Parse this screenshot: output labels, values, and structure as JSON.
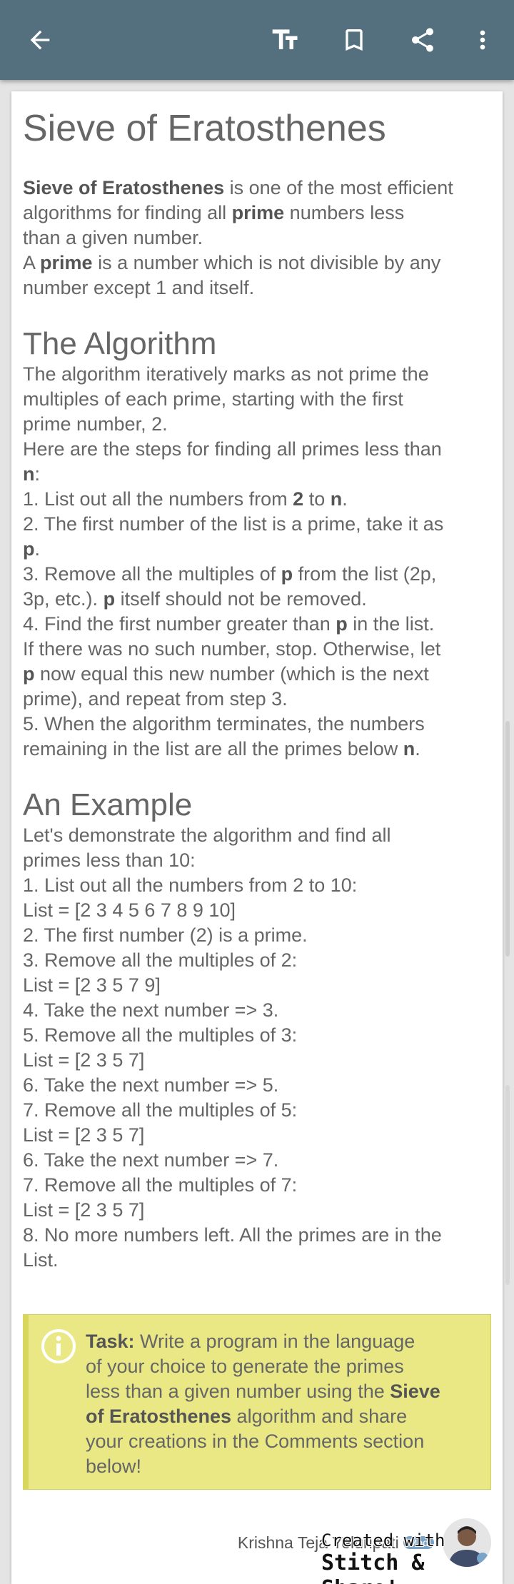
{
  "toolbar": {
    "back_icon": "arrow-left-icon",
    "text_size_icon": "text-size-icon",
    "bookmark_icon": "bookmark-icon",
    "share_icon": "share-icon",
    "more_icon": "more-vert-icon",
    "bar_color": "#54707f"
  },
  "article": {
    "title": "Sieve of Eratosthenes",
    "intro": {
      "p1_bold": "Sieve of Eratosthenes",
      "p1_a": " is one of the most efficient",
      "p1_b": "algorithms for finding all ",
      "p1_prime": "prime",
      "p1_c": " numbers less",
      "p1_d": "than a given number.",
      "p2_a": "A ",
      "p2_prime": "prime",
      "p2_b": " is a number which is not divisible by any",
      "p2_c": "number except 1 and itself."
    },
    "algorithm": {
      "heading": "The Algorithm",
      "l1": "The algorithm iteratively marks as not prime the",
      "l2": "multiples of each prime, starting with the first",
      "l3": "prime number, 2.",
      "l4": "Here are the steps for finding all primes less than",
      "l5_n": "n",
      "l5_colon": ":",
      "s1_a": "1. List out all the numbers from ",
      "s1_2": "2",
      "s1_b": " to ",
      "s1_n": "n",
      "s1_c": ".",
      "s2_a": "2. The first number of the list is a prime, take it as",
      "s2_p": "p",
      "s2_b": ".",
      "s3_a": "3. Remove all the multiples of ",
      "s3_p": "p",
      "s3_b": " from the list (2p,",
      "s3_c": "3p, etc.). ",
      "s3_p2": "p",
      "s3_d": " itself should not be removed.",
      "s4_a": "4. Find the first number greater than ",
      "s4_p": "p",
      "s4_b": " in the list.",
      "s4_c": "If there was no such number, stop. Otherwise, let",
      "s4_p2": "p",
      "s4_d": " now equal this new number (which is the next",
      "s4_e": "prime), and repeat from step 3.",
      "s5_a": "5. When the algorithm terminates, the numbers",
      "s5_b": "remaining in the list are all the primes below ",
      "s5_n": "n",
      "s5_c": "."
    },
    "example": {
      "heading": "An Example",
      "lines": [
        "Let's demonstrate the algorithm and find all",
        "primes less than 10:",
        "1. List out all the numbers from 2 to 10:",
        "List = [2 3 4 5 6 7 8 9 10]",
        "2. The first number (2) is a prime.",
        "3. Remove all the multiples of 2:",
        "List = [2 3 5 7 9]",
        "4. Take the next number => 3.",
        "5. Remove all the multiples of 3:",
        "List = [2 3 5 7]",
        "6. Take the next number => 5.",
        "7. Remove all the multiples of 5:",
        "List = [2 3 5 7]",
        "6. Take the next number => 7.",
        "7. Remove all the multiples of 7:",
        "List = [2 3 5 7]",
        "8. No more numbers left. All the primes are in the",
        "List."
      ]
    },
    "task": {
      "icon": "info-icon",
      "label": "Task:",
      "t1": " Write a program in the language",
      "t2": "of your choice to generate the primes",
      "t3": "less than a given number using the ",
      "t3_bold": "Sieve",
      "t4_bold": "of Eratosthenes",
      "t4": " algorithm and share",
      "t5": "your creations in the Comments section",
      "t6": "below!",
      "bg_color": "#e9e885"
    },
    "author": {
      "name": "Krishna Teja Yeluripati",
      "badge": "Mod"
    }
  },
  "watermark": {
    "line1": "Created with",
    "line2": "Stitch & Share!"
  }
}
